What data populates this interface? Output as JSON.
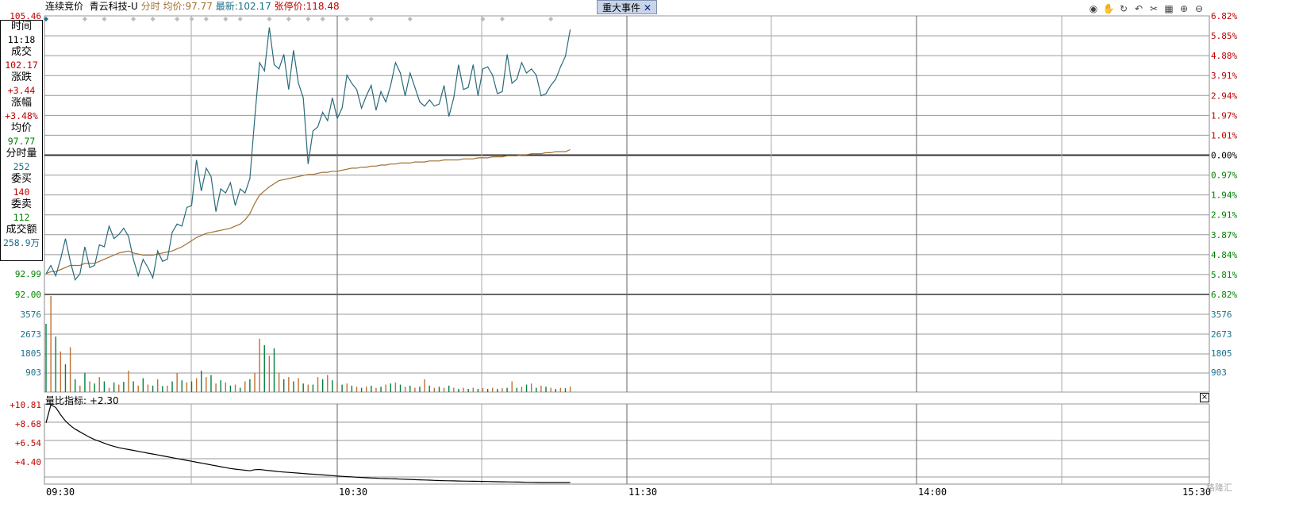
{
  "header": {
    "mode_label": "连续竞价",
    "stock_name": "青云科技-U",
    "view_label": "分时",
    "avg_label": "均价:",
    "avg_value": "97.77",
    "latest_label": "最新:",
    "latest_value": "102.17",
    "limit_up_label": "张停价:",
    "limit_up_value": "118.48",
    "event_button": "重大事件",
    "event_close": "✕"
  },
  "toolbar": {
    "icons": [
      "eye-icon",
      "hand-icon",
      "refresh-icon",
      "undo-icon",
      "scissors-icon",
      "grid-icon",
      "zoom-in-icon",
      "zoom-out-icon"
    ]
  },
  "info_panel": {
    "time_label": "时间",
    "time_value": "11:18",
    "trade_label": "成交",
    "trade_value": "102.17",
    "change_label": "涨跌",
    "change_value": "+3.44",
    "pct_label": "涨幅",
    "pct_value": "+3.48%",
    "avg_label": "均价",
    "avg_value": "97.77",
    "vol_label": "分时量",
    "vol_value": "252",
    "bid_label": "委买",
    "bid_value": "140",
    "ask_label": "委卖",
    "ask_value": "112",
    "amount_label": "成交额",
    "amount_value": "258.9万"
  },
  "volume_ratio": {
    "label": "量比指标:",
    "value": "+2.30"
  },
  "time_axis": [
    "09:30",
    "10:30",
    "11:30",
    "14:00",
    "15:30"
  ],
  "watermark": "格隆汇",
  "colors": {
    "up": "#c00000",
    "down": "#008000",
    "price_line": "#2a6a7a",
    "avg_line": "#a07030",
    "volume_axis": "#1a6f8a"
  },
  "chart_data": [
    {
      "type": "line",
      "title": "分时",
      "prev_close": 98.73,
      "ylim": [
        92.0,
        105.46
      ],
      "left_ticks": [
        "105.46",
        "92.99",
        "92.00"
      ],
      "right_ticks": [
        "6.82%",
        "5.85%",
        "4.88%",
        "3.91%",
        "2.94%",
        "1.97%",
        "1.01%",
        "0.00%",
        "0.97%",
        "1.94%",
        "2.91%",
        "3.87%",
        "4.84%",
        "5.81%",
        "6.82%"
      ],
      "x_minutes": [
        0,
        1,
        2,
        3,
        4,
        5,
        6,
        7,
        8,
        9,
        10,
        11,
        12,
        13,
        14,
        15,
        16,
        17,
        18,
        19,
        20,
        21,
        22,
        23,
        24,
        25,
        26,
        27,
        28,
        29,
        30,
        31,
        32,
        33,
        34,
        35,
        36,
        37,
        38,
        39,
        40,
        41,
        42,
        43,
        44,
        45,
        46,
        47,
        48,
        49,
        50,
        51,
        52,
        53,
        54,
        55,
        56,
        57,
        58,
        59,
        60,
        61,
        62,
        63,
        64,
        65,
        66,
        67,
        68,
        69,
        70,
        71,
        72,
        73,
        74,
        75,
        76,
        77,
        78,
        79,
        80,
        81,
        82,
        83,
        84,
        85,
        86,
        87,
        88,
        89,
        90,
        91,
        92,
        93,
        94,
        95,
        96,
        97,
        98,
        99,
        100,
        101,
        102,
        103,
        104,
        105,
        106,
        107,
        108
      ],
      "series": [
        {
          "name": "最新",
          "values": [
            93.0,
            93.4,
            92.9,
            93.7,
            94.7,
            93.6,
            92.7,
            93.0,
            94.3,
            93.3,
            93.4,
            94.4,
            94.3,
            95.3,
            94.7,
            94.9,
            95.2,
            94.8,
            93.7,
            92.9,
            93.7,
            93.3,
            92.8,
            94.1,
            93.6,
            93.7,
            95.0,
            95.4,
            95.3,
            96.2,
            96.3,
            98.5,
            97.0,
            98.1,
            97.7,
            96.0,
            97.1,
            96.9,
            97.4,
            96.3,
            97.1,
            96.9,
            97.6,
            100.5,
            103.2,
            102.8,
            104.9,
            103.1,
            102.9,
            103.6,
            101.9,
            103.8,
            102.2,
            101.5,
            98.3,
            99.9,
            100.1,
            100.8,
            100.4,
            101.5,
            100.5,
            101.0,
            102.6,
            102.2,
            101.9,
            101.0,
            101.6,
            102.1,
            100.9,
            101.8,
            101.3,
            102.1,
            103.2,
            102.7,
            101.6,
            102.7,
            102.0,
            101.3,
            101.1,
            101.4,
            101.1,
            101.2,
            102.1,
            100.6,
            101.5,
            103.1,
            101.9,
            102.0,
            103.1,
            101.6,
            102.9,
            103.0,
            102.6,
            101.7,
            101.8,
            103.6,
            102.2,
            102.4,
            103.2,
            102.7,
            102.9,
            102.6,
            101.6,
            101.7,
            102.1,
            102.4,
            103.0,
            103.5,
            104.8
          ],
          "color": "#2a6a7a"
        },
        {
          "name": "均价",
          "values": [
            93.0,
            93.1,
            93.1,
            93.2,
            93.3,
            93.4,
            93.4,
            93.4,
            93.5,
            93.5,
            93.5,
            93.6,
            93.7,
            93.8,
            93.9,
            94.0,
            94.05,
            94.1,
            94.0,
            93.95,
            93.9,
            93.9,
            93.9,
            93.95,
            94.0,
            94.05,
            94.1,
            94.2,
            94.3,
            94.45,
            94.6,
            94.75,
            94.85,
            94.95,
            95.0,
            95.05,
            95.1,
            95.15,
            95.2,
            95.3,
            95.4,
            95.6,
            95.9,
            96.4,
            96.8,
            97.0,
            97.2,
            97.35,
            97.5,
            97.55,
            97.6,
            97.65,
            97.7,
            97.75,
            97.8,
            97.8,
            97.85,
            97.9,
            97.9,
            97.95,
            97.95,
            98.0,
            98.05,
            98.1,
            98.1,
            98.15,
            98.15,
            98.2,
            98.2,
            98.25,
            98.25,
            98.3,
            98.3,
            98.35,
            98.35,
            98.35,
            98.4,
            98.4,
            98.4,
            98.45,
            98.45,
            98.45,
            98.5,
            98.5,
            98.5,
            98.5,
            98.55,
            98.55,
            98.55,
            98.6,
            98.6,
            98.6,
            98.65,
            98.65,
            98.65,
            98.7,
            98.7,
            98.7,
            98.75,
            98.75,
            98.8,
            98.8,
            98.8,
            98.85,
            98.85,
            98.9,
            98.9,
            98.9,
            99.0
          ],
          "color": "#a07030"
        }
      ]
    },
    {
      "type": "bar",
      "title": "成交量",
      "ylim": [
        0,
        4500
      ],
      "ticks": [
        "3576",
        "2673",
        "1805",
        "903"
      ],
      "values": [
        3200,
        4500,
        2600,
        1900,
        1300,
        2100,
        600,
        300,
        900,
        500,
        400,
        700,
        500,
        200,
        450,
        350,
        480,
        1000,
        500,
        300,
        650,
        350,
        300,
        600,
        280,
        300,
        500,
        900,
        550,
        450,
        500,
        650,
        1000,
        700,
        800,
        400,
        550,
        450,
        300,
        350,
        200,
        500,
        600,
        900,
        2500,
        2200,
        1700,
        2050,
        900,
        600,
        700,
        500,
        650,
        400,
        350,
        350,
        700,
        600,
        800,
        550,
        450,
        350,
        400,
        300,
        250,
        200,
        250,
        300,
        200,
        250,
        350,
        400,
        450,
        350,
        250,
        300,
        200,
        250,
        600,
        300,
        200,
        250,
        200,
        300,
        200,
        150,
        200,
        150,
        200,
        150,
        180,
        150,
        200,
        150,
        180,
        200,
        500,
        200,
        250,
        350,
        400,
        200,
        300,
        250,
        200,
        150,
        200,
        180,
        252
      ],
      "up_mask": [
        0,
        1,
        0,
        1,
        0,
        1,
        0,
        1,
        0,
        1,
        0,
        1,
        0,
        1,
        0,
        1,
        0,
        1,
        0,
        1,
        0,
        1,
        0,
        1,
        0,
        1,
        0,
        1,
        0,
        1,
        0,
        1,
        0,
        1,
        0,
        1,
        0,
        1,
        0,
        1,
        0,
        1,
        0,
        1,
        1,
        0,
        1,
        0,
        1,
        0,
        1,
        0,
        1,
        0,
        1,
        0,
        1,
        0,
        1,
        0,
        1,
        0,
        1,
        0,
        1,
        0,
        1,
        0,
        1,
        0,
        1,
        0,
        1,
        0,
        1,
        0,
        1,
        0,
        1,
        0,
        1,
        0,
        1,
        0,
        1,
        0,
        1,
        0,
        1,
        0,
        1,
        0,
        1,
        0,
        1,
        0,
        1,
        0,
        1,
        0,
        1,
        0,
        1,
        0,
        1,
        0,
        1,
        0,
        1
      ]
    },
    {
      "type": "line",
      "title": "量比指标",
      "ylim": [
        2.3,
        10.81
      ],
      "ticks": [
        "+10.81",
        "+8.68",
        "+6.54",
        "+4.40"
      ],
      "values": [
        8.9,
        10.9,
        10.6,
        9.8,
        9.1,
        8.6,
        8.2,
        7.9,
        7.6,
        7.3,
        7.05,
        6.85,
        6.65,
        6.45,
        6.3,
        6.15,
        6.05,
        5.95,
        5.85,
        5.75,
        5.65,
        5.55,
        5.45,
        5.35,
        5.25,
        5.15,
        5.05,
        4.95,
        4.85,
        4.75,
        4.65,
        4.55,
        4.45,
        4.35,
        4.25,
        4.15,
        4.05,
        3.95,
        3.85,
        3.78,
        3.72,
        3.66,
        3.6,
        3.72,
        3.75,
        3.68,
        3.62,
        3.56,
        3.5,
        3.46,
        3.42,
        3.38,
        3.34,
        3.3,
        3.26,
        3.22,
        3.18,
        3.14,
        3.1,
        3.06,
        3.02,
        2.98,
        2.95,
        2.92,
        2.89,
        2.86,
        2.83,
        2.8,
        2.78,
        2.76,
        2.74,
        2.72,
        2.7,
        2.68,
        2.66,
        2.64,
        2.62,
        2.6,
        2.58,
        2.56,
        2.54,
        2.52,
        2.5,
        2.49,
        2.48,
        2.47,
        2.46,
        2.45,
        2.44,
        2.43,
        2.42,
        2.41,
        2.4,
        2.39,
        2.38,
        2.37,
        2.36,
        2.35,
        2.34,
        2.33,
        2.32,
        2.31,
        2.3,
        2.3,
        2.3,
        2.3,
        2.3,
        2.3,
        2.3
      ],
      "color": "#000000"
    }
  ]
}
